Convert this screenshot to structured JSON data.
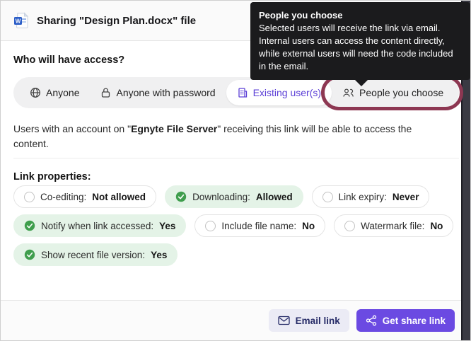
{
  "header": {
    "title": "Sharing \"Design Plan.docx\" file",
    "file_icon": "word-doc-icon"
  },
  "tooltip": {
    "title": "People you choose",
    "body": "Selected users will receive the link via email. Internal users can access the content directly, while external users will need the code included in the email."
  },
  "access": {
    "question": "Who will have access?",
    "segments": [
      {
        "label": "Anyone",
        "icon": "globe-icon",
        "selected": false
      },
      {
        "label": "Anyone with password",
        "icon": "lock-icon",
        "selected": false
      },
      {
        "label": "Existing user(s)",
        "icon": "building-icon",
        "selected": true
      },
      {
        "label": "People you choose",
        "icon": "people-icon",
        "selected": false,
        "annotated": true
      }
    ],
    "description_prefix": "Users with an account on \"",
    "description_server": "Egnyte File Server",
    "description_suffix": "\" receiving this link will be able to access the content."
  },
  "link_properties": {
    "heading": "Link properties:",
    "items": [
      {
        "label": "Co-editing:",
        "value": "Not allowed",
        "state": "off"
      },
      {
        "label": "Downloading:",
        "value": "Allowed",
        "state": "on"
      },
      {
        "label": "Link expiry:",
        "value": "Never",
        "state": "off"
      },
      {
        "label": "Notify when link accessed:",
        "value": "Yes",
        "state": "on"
      },
      {
        "label": "Include file name:",
        "value": "No",
        "state": "off"
      },
      {
        "label": "Watermark file:",
        "value": "No",
        "state": "off"
      },
      {
        "label": "Show recent file version:",
        "value": "Yes",
        "state": "on"
      }
    ]
  },
  "footer": {
    "email_link_label": "Email link",
    "get_share_link_label": "Get share link"
  },
  "colors": {
    "accent_purple": "#6b4ae2",
    "selected_tab_purple": "#5b3fd6",
    "success_green": "#3f9e4d",
    "success_pill_bg": "#e4f3e7",
    "annotation_maroon": "#8d3752",
    "tooltip_bg": "#1b1b1d"
  }
}
